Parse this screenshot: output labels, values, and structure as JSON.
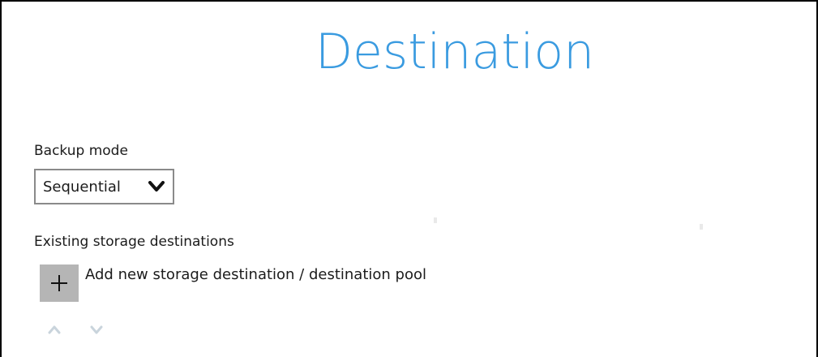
{
  "page": {
    "title": "Destination"
  },
  "backup_mode": {
    "label": "Backup mode",
    "selected": "Sequential"
  },
  "storage": {
    "section_label": "Existing storage destinations",
    "add_label": "Add new storage destination / destination pool"
  },
  "icons": {
    "dropdown": "chevron-down-icon",
    "add": "plus-icon",
    "move_up": "chevron-up-icon",
    "move_down": "chevron-down-icon"
  },
  "colors": {
    "title": "#3a9be0",
    "add_button_bg": "#b5b5b5",
    "move_arrows": "#c9d4dc"
  }
}
